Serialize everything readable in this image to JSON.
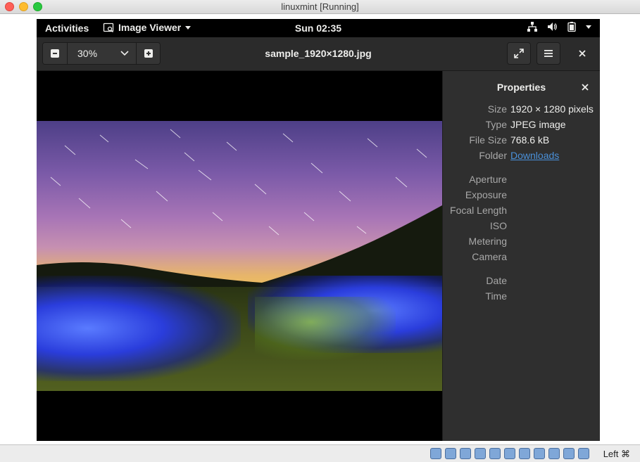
{
  "host": {
    "window_title": "linuxmint [Running]",
    "host_key": "Left ⌘"
  },
  "topbar": {
    "activities": "Activities",
    "app_name": "Image Viewer",
    "clock": "Sun 02:35"
  },
  "headerbar": {
    "zoom_value": "30%",
    "title": "sample_1920×1280.jpg"
  },
  "properties": {
    "title": "Properties",
    "rows": [
      {
        "label": "Size",
        "value": "1920 × 1280 pixels"
      },
      {
        "label": "Type",
        "value": "JPEG image"
      },
      {
        "label": "File Size",
        "value": "768.6 kB"
      },
      {
        "label": "Folder",
        "value": "Downloads"
      },
      {
        "label": "Aperture",
        "value": ""
      },
      {
        "label": "Exposure",
        "value": ""
      },
      {
        "label": "Focal Length",
        "value": ""
      },
      {
        "label": "ISO",
        "value": ""
      },
      {
        "label": "Metering",
        "value": ""
      },
      {
        "label": "Camera",
        "value": ""
      },
      {
        "label": "Date",
        "value": ""
      },
      {
        "label": "Time",
        "value": ""
      }
    ]
  },
  "colors": {
    "link": "#4a90d9",
    "sidebar_bg": "#2f2f2f",
    "header_bg": "#2b2b2b"
  }
}
